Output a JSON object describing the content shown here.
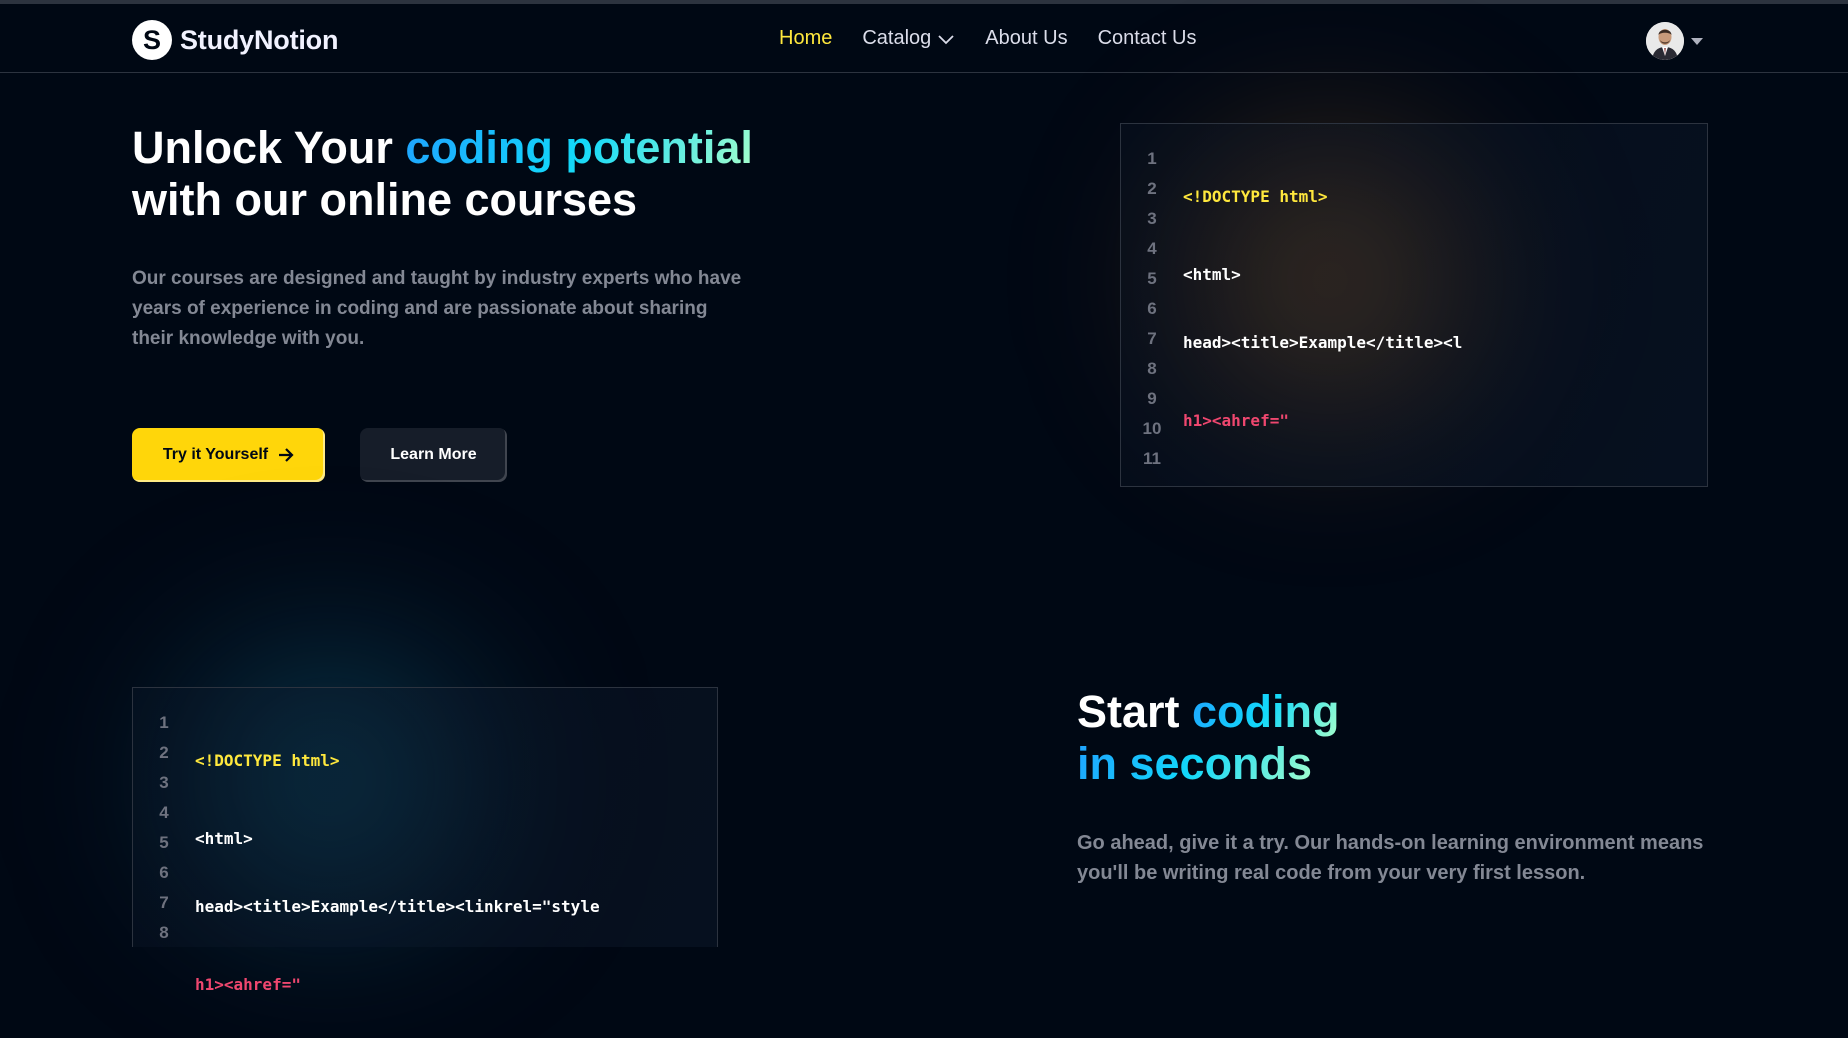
{
  "brand": {
    "name": "StudyNotion",
    "logo_letter": "S"
  },
  "nav": {
    "links": [
      {
        "label": "Home",
        "active": true
      },
      {
        "label": "Catalog",
        "dropdown": true
      },
      {
        "label": "About Us"
      },
      {
        "label": "Contact Us"
      }
    ]
  },
  "profile": {
    "icon": "chevron-down-icon"
  },
  "hero": {
    "title_part1": "Unlock Your ",
    "title_highlight": "coding potential",
    "title_part2": "with our online courses",
    "description": "Our courses are designed and taught by industry experts who have years of experience in coding and are passionate about sharing their knowledge with you.",
    "primary_button": "Try it Yourself",
    "secondary_button": "Learn More"
  },
  "code_block_1": {
    "line_numbers": [
      "1",
      "2",
      "3",
      "4",
      "5",
      "6",
      "7",
      "8",
      "9",
      "10",
      "11"
    ],
    "lines": [
      "<!DOCTYPE html>",
      "<html>",
      "head><title>Example</title><l",
      "h1><ahref=\""
    ]
  },
  "code_block_2": {
    "line_numbers": [
      "1",
      "2",
      "3",
      "4",
      "5",
      "6",
      "7",
      "8"
    ],
    "lines": [
      "<!DOCTYPE html>",
      "<html>",
      "head><title>Example</title><linkrel=\"style",
      "h1><ahref=\""
    ]
  },
  "section2": {
    "title_part1": "Start ",
    "title_highlight1": "coding",
    "title_highlight2": "in seconds",
    "description": "Go ahead, give it a try. Our hands-on learning environment means you'll be writing real code from your very first lesson."
  },
  "colors": {
    "background": "#000814",
    "accent_yellow": "#FFD60A",
    "nav_active": "#FFE83D",
    "gradient_text": "#12D8FA",
    "code_red": "#EF476F"
  }
}
